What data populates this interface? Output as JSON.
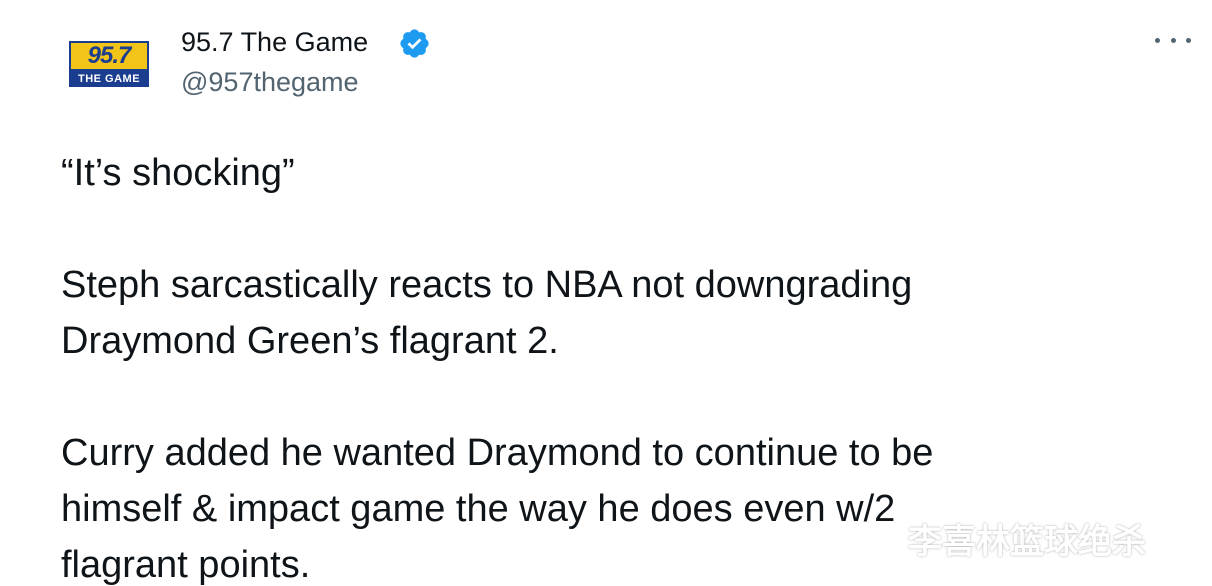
{
  "tweet": {
    "avatar": {
      "number": "95.7",
      "subtitle": "THE GAME"
    },
    "display_name": "95.7 The Game",
    "handle": "@957thegame",
    "verified": true,
    "paragraphs": [
      [
        "“It’s shocking”"
      ],
      [
        "Steph sarcastically reacts to NBA not downgrading",
        "Draymond Green’s flagrant 2."
      ],
      [
        "Curry added he wanted Draymond to continue to be",
        "himself & impact game the way he does even w/2",
        "flagrant points."
      ]
    ]
  },
  "watermark": "李喜林篮球绝杀",
  "colors": {
    "verified": "#1d9bf0",
    "text": "#0f1419",
    "secondary": "#536471",
    "brand_yellow": "#f2c418",
    "brand_blue": "#1b3d8f"
  }
}
